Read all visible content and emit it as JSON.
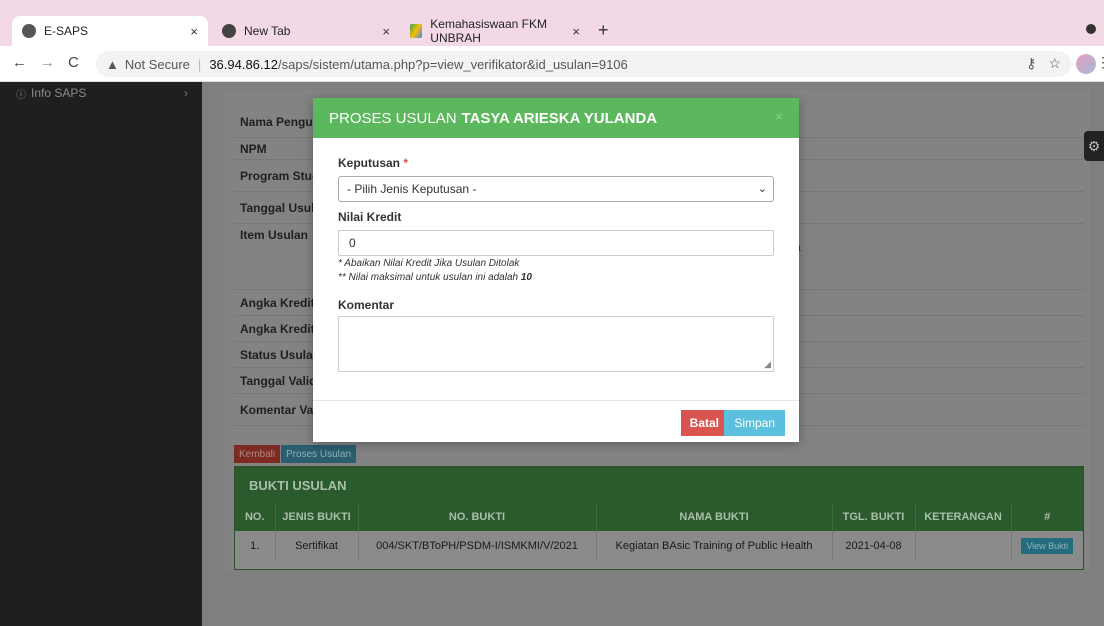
{
  "browser": {
    "tabs": [
      {
        "title": "E-SAPS",
        "close": "×"
      },
      {
        "title": "New Tab",
        "close": "×"
      },
      {
        "title": "Kemahasiswaan FKM UNBRAH",
        "close": "×"
      }
    ],
    "new_tab": "+",
    "security_label": "Not Secure",
    "url_host": "36.94.86.12",
    "url_path": "/saps/sistem/utama.php?p=view_verifikator&id_usulan=9106"
  },
  "sidebar": {
    "items": [
      {
        "label": "Info SAPS",
        "chevron": "›"
      }
    ]
  },
  "detail": {
    "rows": [
      {
        "label": "Nama Pengusu"
      },
      {
        "label": "NPM"
      },
      {
        "label": "Program Studi"
      },
      {
        "label": "Tanggal Usulan"
      },
      {
        "label": "Item Usulan"
      },
      {
        "label": "Angka Kredit D"
      },
      {
        "label": "Angka Kredit A"
      },
      {
        "label": "Status Usulan"
      },
      {
        "label": "Tanggal Valida"
      },
      {
        "label": "Komentar Vali"
      }
    ],
    "item_usulan_tail": "a"
  },
  "actions": {
    "kembali": "Kembali",
    "proses": "Proses Usulan"
  },
  "bukti": {
    "title": "BUKTI USULAN",
    "columns": [
      "NO.",
      "JENIS BUKTI",
      "NO. BUKTI",
      "NAMA BUKTI",
      "TGL. BUKTI",
      "KETERANGAN",
      "#"
    ],
    "rows": [
      {
        "no": "1.",
        "jenis": "Sertifikat",
        "nomor": "004/SKT/BToPH/PSDM-I/ISMKMI/V/2021",
        "nama": "Kegiatan BAsic Training of Public Health",
        "tgl": "2021-04-08",
        "keterangan": "",
        "action": "View Bukti"
      }
    ]
  },
  "modal": {
    "title_prefix": "PROSES USULAN",
    "title_name": "TASYA ARIESKA YULANDA",
    "close": "×",
    "keputusan_label": "Keputusan",
    "required_mark": "*",
    "keputusan_value": "- Pilih Jenis Keputusan -",
    "nilai_label": "Nilai Kredit",
    "nilai_value": "0",
    "note1": "* Abaikan Nilai Kredit Jika Usulan Ditolak",
    "note2_prefix": "** Nilai maksimal untuk usulan ini adalah",
    "note2_max": "10",
    "komentar_label": "Komentar",
    "batal": "Batal",
    "simpan": "Simpan"
  },
  "colors": {
    "modal_header": "#5cb85c",
    "batal": "#d9534f",
    "simpan": "#5bc0de"
  }
}
